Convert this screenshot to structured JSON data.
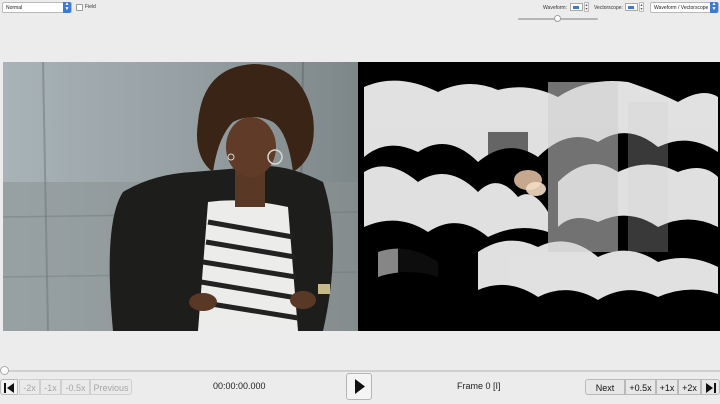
{
  "toolbar": {
    "mode_select": "Normal",
    "field_checkbox_label": "Field",
    "field_checked": false,
    "waveform_label": "Waveform:",
    "waveform_value": "",
    "vectorscope_label": "Vectorscope:",
    "vectorscope_value": "",
    "display_select": "Waveform / Vectorscope"
  },
  "transport": {
    "minus2x": "-2x",
    "minus1x": "-1x",
    "minus05x": "-0.5x",
    "previous": "Previous",
    "timecode": "00:00:00.000",
    "frame": "Frame 0 [I]",
    "next": "Next",
    "plus05x": "+0.5x",
    "plus1x": "+1x",
    "plus2x": "+2x"
  },
  "colors": {
    "accent": "#3a7bd5",
    "background": "#ececec",
    "scope_background": "#000000"
  }
}
